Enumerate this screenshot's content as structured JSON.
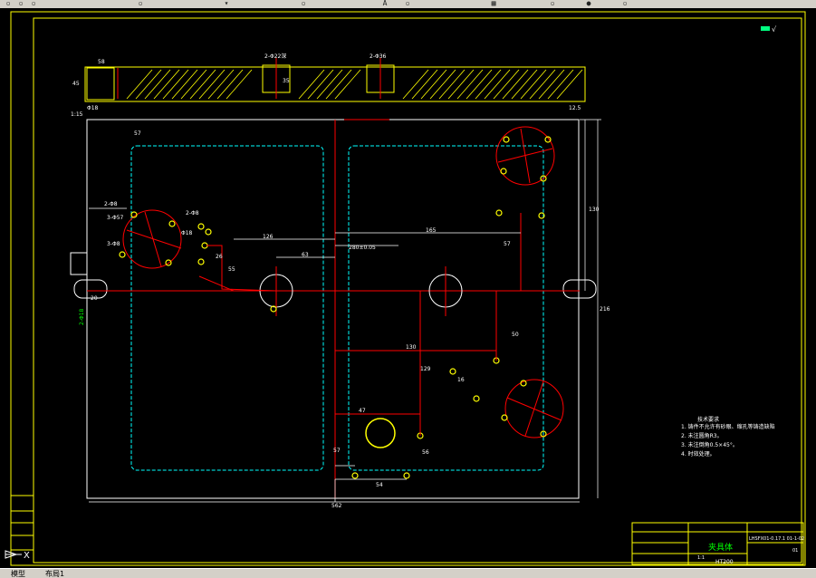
{
  "toolbar": {
    "icons": [
      "zoom-icon",
      "zoom-in-icon",
      "zoom-out-icon",
      "zoom-window-icon",
      "text-icon",
      "dimension-icon",
      "layer-icon",
      "properties-icon",
      "table-icon",
      "layers-manager-icon",
      "color-icon",
      "linetype-icon"
    ]
  },
  "drawing": {
    "cross_section_dims": {
      "top_left": "58",
      "mid_1": "2-Φ22深",
      "mid_2": "2-Φ36",
      "left_vert": "45",
      "center_vert": "35",
      "left_bottom": "Φ18",
      "left_bottom_2": "1:15"
    },
    "plan_dims": {
      "top_left_dim": "57",
      "d1": "2-Φ8",
      "d2": "3-Φ57",
      "d3": "2-Φ8",
      "d4": "3-Φ8",
      "d5": "Φ18",
      "d6": "126",
      "d7": "165",
      "d8": "280±0.05",
      "d9": "63",
      "d10": "55",
      "d11": "26",
      "d12": "20",
      "d13": "57",
      "d14": "47",
      "d15": "130",
      "d16": "129",
      "d17": "50",
      "d18": "16",
      "d19": "57",
      "d20": "54",
      "d21": "56",
      "right_vert_1": "130",
      "right_vert_2": "216",
      "bottom_width": "562",
      "left_label": "2-Φ18"
    },
    "notes": {
      "heading": "技术要求",
      "items": [
        "1. 铸件不允许有砂眼、缩孔等铸造缺陷",
        "2. 未注圆角R3。",
        "3. 未注倒角0.5×45°。",
        "4. 时效处理。"
      ]
    },
    "title_block": {
      "name": "夹具体",
      "drawing_no": "LHSFX01-0.17.1 01-1-02",
      "material": "HT200",
      "scale": "1:1",
      "sheet": "01"
    },
    "roughness_top_right": "12.5"
  },
  "status": {
    "tabs": [
      "模型",
      "布局1"
    ]
  },
  "colors": {
    "yellow": "#ffff00",
    "red": "#ff0000",
    "cyan": "#00ffff",
    "white": "#ffffff",
    "green": "#00ff00"
  }
}
